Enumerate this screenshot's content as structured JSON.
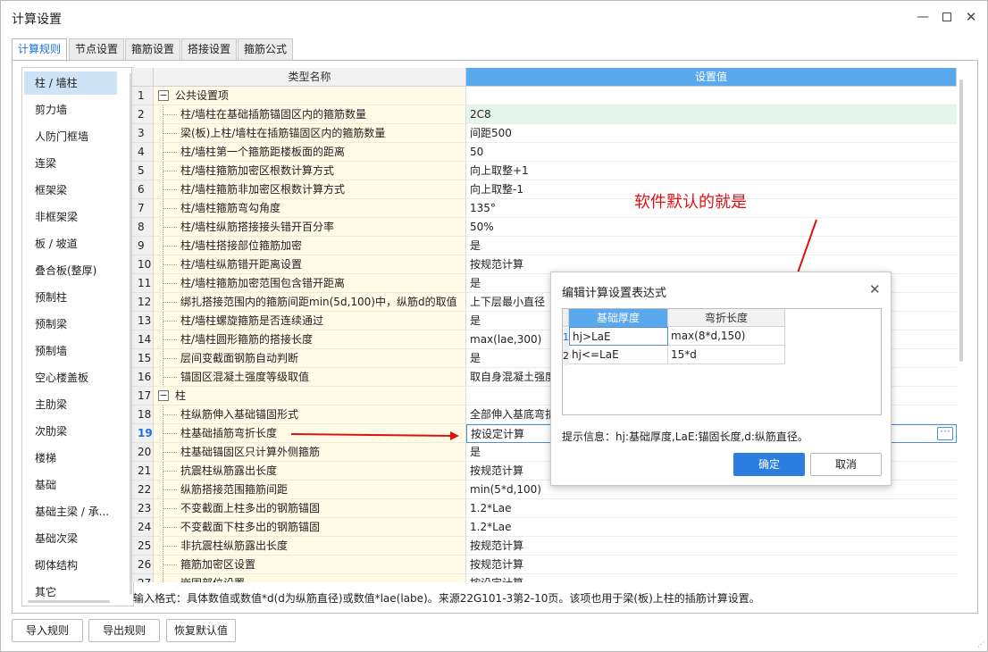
{
  "window": {
    "title": "计算设置",
    "minimize_icon": "minimize-icon",
    "maximize_icon": "maximize-icon",
    "close_icon": "close-icon",
    "close_glyph": "✕",
    "min_glyph": "—"
  },
  "tabs": [
    "计算规则",
    "节点设置",
    "箍筋设置",
    "搭接设置",
    "箍筋公式"
  ],
  "sidebar": {
    "items": [
      "柱 / 墙柱",
      "剪力墙",
      "人防门框墙",
      "连梁",
      "框架梁",
      "非框架梁",
      "板 / 坡道",
      "叠合板(整厚)",
      "预制柱",
      "预制梁",
      "预制墙",
      "空心楼盖板",
      "主肋梁",
      "次肋梁",
      "楼梯",
      "基础",
      "基础主梁 / 承...",
      "基础次梁",
      "砌体结构",
      "其它"
    ]
  },
  "grid": {
    "header_name": "类型名称",
    "header_value": "设置值",
    "rows": [
      {
        "num": "1",
        "name": "公共设置项",
        "value": "",
        "group": true
      },
      {
        "num": "2",
        "name": "柱/墙柱在基础插筋锚固区内的箍筋数量",
        "value": "2C8"
      },
      {
        "num": "3",
        "name": "梁(板)上柱/墙柱在插筋锚固区内的箍筋数量",
        "value": "间距500"
      },
      {
        "num": "4",
        "name": "柱/墙柱第一个箍筋距楼板面的距离",
        "value": "50"
      },
      {
        "num": "5",
        "name": "柱/墙柱箍筋加密区根数计算方式",
        "value": "向上取整+1"
      },
      {
        "num": "6",
        "name": "柱/墙柱箍筋非加密区根数计算方式",
        "value": "向上取整-1"
      },
      {
        "num": "7",
        "name": "柱/墙柱箍筋弯勾角度",
        "value": "135°"
      },
      {
        "num": "8",
        "name": "柱/墙柱纵筋搭接接头错开百分率",
        "value": "50%"
      },
      {
        "num": "9",
        "name": "柱/墙柱搭接部位箍筋加密",
        "value": "是"
      },
      {
        "num": "10",
        "name": "柱/墙柱纵筋错开距离设置",
        "value": "按规范计算"
      },
      {
        "num": "11",
        "name": "柱/墙柱箍筋加密范围包含错开距离",
        "value": "是"
      },
      {
        "num": "12",
        "name": "绑扎搭接范围内的箍筋间距min(5d,100)中，纵筋d的取值",
        "value": "上下层最小直径"
      },
      {
        "num": "13",
        "name": "柱/墙柱螺旋箍筋是否连续通过",
        "value": "是"
      },
      {
        "num": "14",
        "name": "柱/墙柱圆形箍筋的搭接长度",
        "value": "max(lae,300)"
      },
      {
        "num": "15",
        "name": "层间变截面钢筋自动判断",
        "value": "是"
      },
      {
        "num": "16",
        "name": "锚固区混凝土强度等级取值",
        "value": "取自身混凝土强度"
      },
      {
        "num": "17",
        "name": "柱",
        "value": "",
        "group": true
      },
      {
        "num": "18",
        "name": "柱纵筋伸入基础锚固形式",
        "value": "全部伸入基底弯折"
      },
      {
        "num": "19",
        "name": "柱基础插筋弯折长度",
        "value": "按设定计算",
        "current": true
      },
      {
        "num": "20",
        "name": "柱基础锚固区只计算外侧箍筋",
        "value": "是"
      },
      {
        "num": "21",
        "name": "抗震柱纵筋露出长度",
        "value": "按规范计算"
      },
      {
        "num": "22",
        "name": "纵筋搭接范围箍筋间距",
        "value": "min(5*d,100)"
      },
      {
        "num": "23",
        "name": "不变截面上柱多出的钢筋锚固",
        "value": "1.2*Lae"
      },
      {
        "num": "24",
        "name": "不变截面下柱多出的钢筋锚固",
        "value": "1.2*Lae"
      },
      {
        "num": "25",
        "name": "非抗震柱纵筋露出长度",
        "value": "按规范计算"
      },
      {
        "num": "26",
        "name": "箍筋加密区设置",
        "value": "按规范计算"
      },
      {
        "num": "27",
        "name": "嵌固部位设置",
        "value": "按设定计算"
      }
    ]
  },
  "hint": "输入格式：具体数值或数值*d(d为纵筋直径)或数值*lae(labe)。来源22G101-3第2-10页。该项也用于梁(板)上柱的插筋计算设置。",
  "buttons": {
    "import": "导入规则",
    "export": "导出规则",
    "restore": "恢复默认值"
  },
  "annotation": "软件默认的就是",
  "dialog": {
    "title": "编辑计算设置表达式",
    "col1": "基础厚度",
    "col2": "弯折长度",
    "rows": [
      {
        "num": "1",
        "cond": "hj>LaE",
        "value": "max(8*d,150)"
      },
      {
        "num": "2",
        "cond": "hj<=LaE",
        "value": "15*d"
      }
    ],
    "hint": "提示信息：hj:基础厚度,LaE:锚固长度,d:纵筋直径。",
    "ok": "确定",
    "cancel": "取消"
  },
  "colors": {
    "accent": "#2b7de0",
    "header_blue": "#5aa8ee",
    "annotation_red": "#e01010",
    "name_col_bg": "#fffbe6"
  }
}
